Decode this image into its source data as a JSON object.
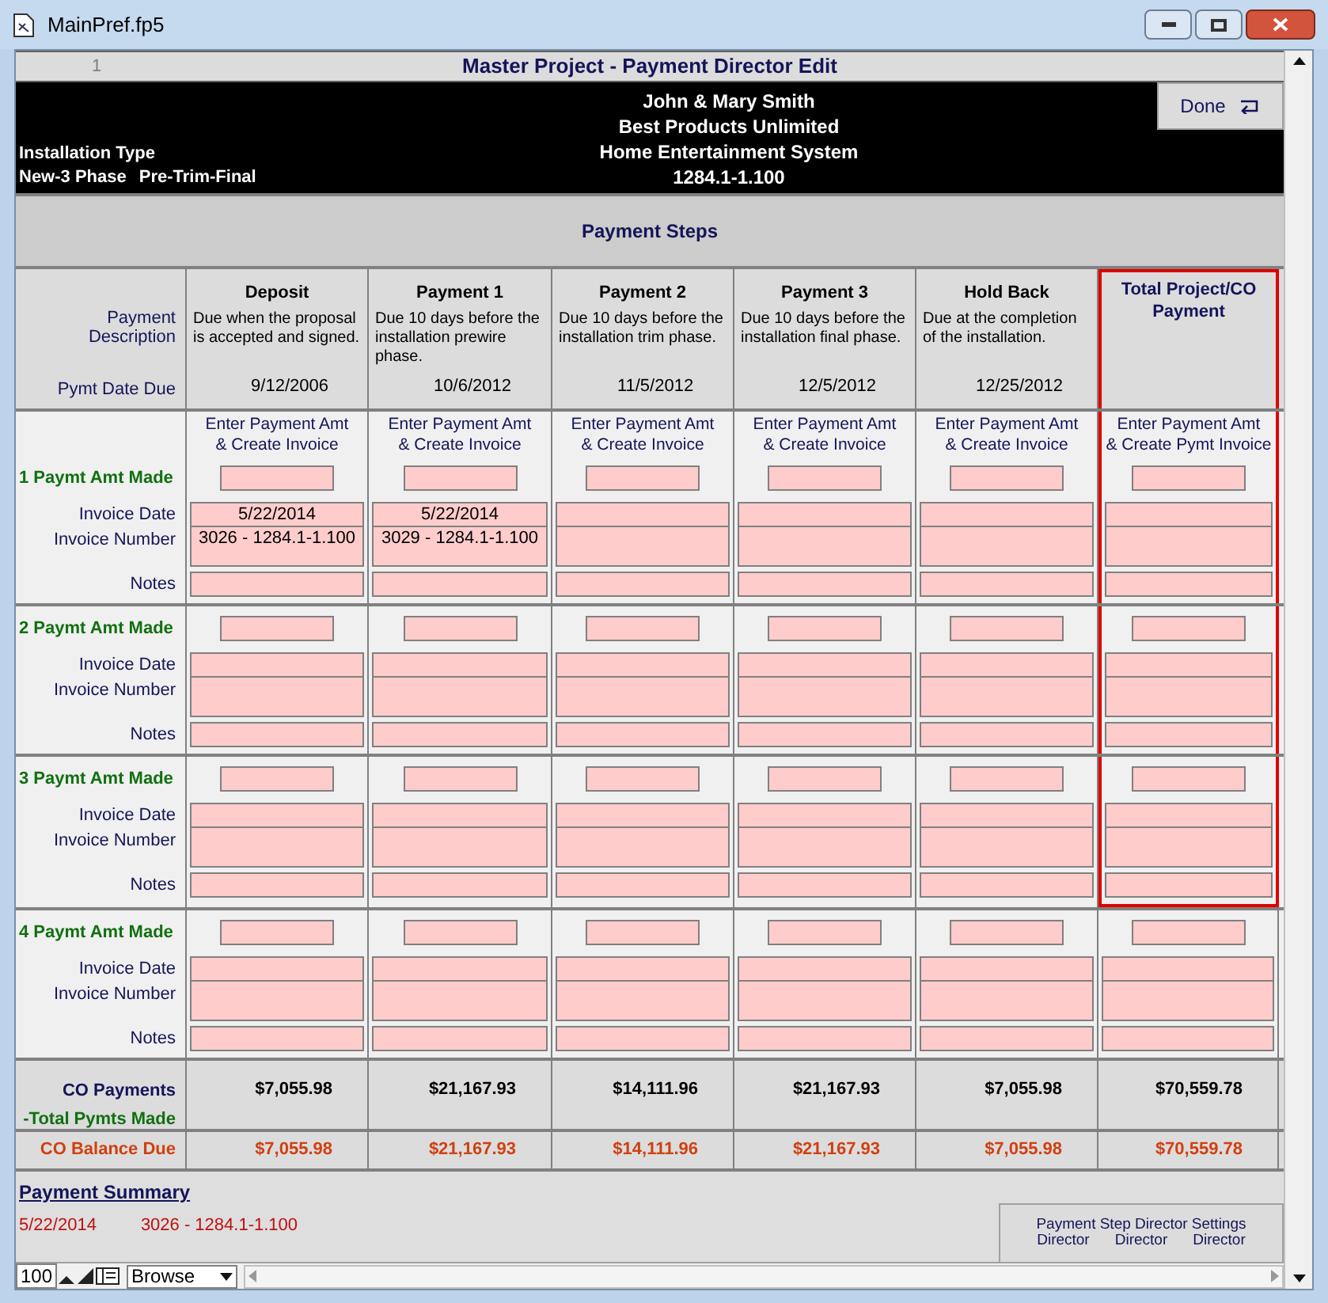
{
  "window": {
    "title": "MainPref.fp5"
  },
  "header": {
    "page_number": "1",
    "title": "Master Project - Payment Director Edit"
  },
  "project": {
    "client": "John & Mary Smith",
    "company": "Best Products Unlimited",
    "system": "Home Entertainment System",
    "job_number": "1284.1-1.100",
    "installation_type_label": "Installation Type",
    "installation_type": "New-3 Phase",
    "phases": "Pre-Trim-Final",
    "done_button": "Done"
  },
  "section_title": "Payment Steps",
  "row_labels": {
    "description": "Payment\nDescription",
    "date_due": "Pymt Date Due",
    "co_payments": "CO Payments",
    "total_made": "-Total Pymts Made",
    "balance": "CO Balance Due"
  },
  "columns": [
    {
      "title": "Deposit",
      "description": "Due when the proposal is accepted and signed.",
      "date_due": "9/12/2006",
      "enter_label": "Enter Payment Amt\n& Create Invoice",
      "co_payments": "$7,055.98",
      "balance": "$7,055.98"
    },
    {
      "title": "Payment 1",
      "description": "Due 10 days before the installation prewire phase.",
      "date_due": "10/6/2012",
      "enter_label": "Enter Payment Amt\n& Create Invoice",
      "co_payments": "$21,167.93",
      "balance": "$21,167.93"
    },
    {
      "title": "Payment 2",
      "description": "Due 10 days before the installation trim phase.",
      "date_due": "11/5/2012",
      "enter_label": "Enter Payment Amt\n& Create Invoice",
      "co_payments": "$14,111.96",
      "balance": "$14,111.96"
    },
    {
      "title": "Payment 3",
      "description": "Due 10 days before the installation final phase.",
      "date_due": "12/5/2012",
      "enter_label": "Enter Payment Amt\n& Create Invoice",
      "co_payments": "$21,167.93",
      "balance": "$21,167.93"
    },
    {
      "title": "Hold Back",
      "description": "Due at the completion of the installation.",
      "date_due": "12/25/2012",
      "enter_label": "Enter Payment Amt\n& Create Invoice",
      "co_payments": "$7,055.98",
      "balance": "$7,055.98"
    },
    {
      "title": "Total Project/CO Payment",
      "enter_label": "Enter Payment Amt\n& Create Pymt Invoice",
      "co_payments": "$70,559.78",
      "balance": "$70,559.78"
    }
  ],
  "payments": [
    {
      "label": "1 Paymt Amt Made",
      "invoice_date_label": "Invoice Date",
      "invoice_number_label": "Invoice Number",
      "notes_label": "Notes",
      "invoices": [
        {
          "date": "5/22/2014",
          "number": "3026 - 1284.1-1.100"
        },
        {
          "date": "5/22/2014",
          "number": "3029 - 1284.1-1.100"
        }
      ]
    },
    {
      "label": "2 Paymt Amt Made",
      "invoice_date_label": "Invoice Date",
      "invoice_number_label": "Invoice Number",
      "notes_label": "Notes"
    },
    {
      "label": "3 Paymt Amt Made",
      "invoice_date_label": "Invoice Date",
      "invoice_number_label": "Invoice Number",
      "notes_label": "Notes"
    },
    {
      "label": "4 Paymt Amt Made",
      "invoice_date_label": "Invoice Date",
      "invoice_number_label": "Invoice Number",
      "notes_label": "Notes"
    }
  ],
  "summary": {
    "title": "Payment Summary",
    "entries": [
      {
        "date": "5/22/2014",
        "invoice": "3026 - 1284.1-1.100"
      }
    ]
  },
  "settings_panel": {
    "title": "Payment Step Director Settings",
    "labels": [
      "Director",
      "Director",
      "Director"
    ]
  },
  "status_bar": {
    "zoom": "100",
    "mode": "Browse"
  }
}
